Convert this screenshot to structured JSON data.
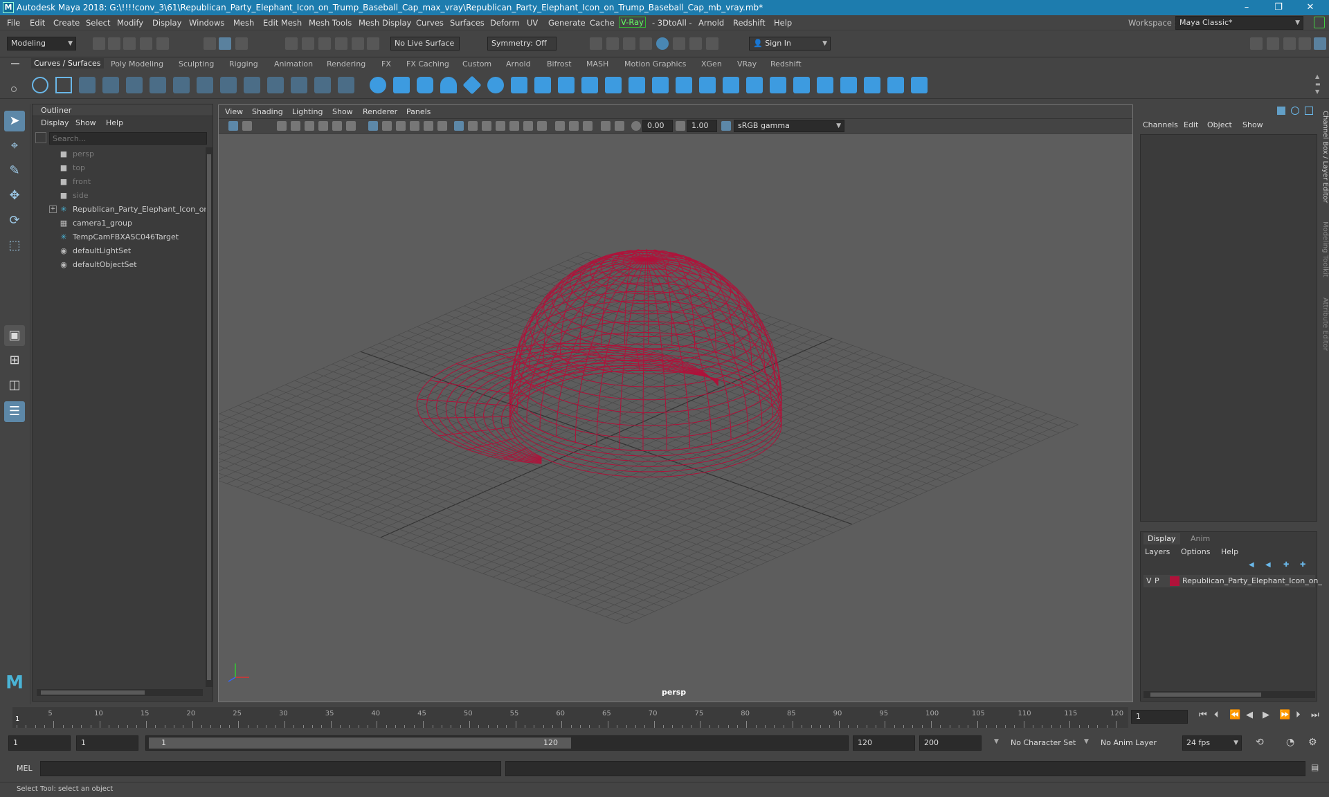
{
  "title": {
    "text": "Autodesk Maya 2018: G:\\!!!!conv_3\\61\\Republican_Party_Elephant_Icon_on_Trump_Baseball_Cap_max_vray\\Republican_Party_Elephant_Icon_on_Trump_Baseball_Cap_mb_vray.mb*",
    "logo": "M",
    "min": "–",
    "max": "❐",
    "close": "✕"
  },
  "menu": [
    "File",
    "Edit",
    "Create",
    "Select",
    "Modify",
    "Display",
    "Windows",
    "Mesh",
    "Edit Mesh",
    "Mesh Tools",
    "Mesh Display",
    "Curves",
    "Surfaces",
    "Deform",
    "UV",
    "Generate",
    "Cache",
    "V-Ray",
    "- 3DtoAll -",
    "Arnold",
    "Redshift",
    "Help"
  ],
  "workspace": {
    "label": "Workspace :",
    "value": "Maya Classic*"
  },
  "status": {
    "mode": "Modeling",
    "live_surface": "No Live Surface",
    "symmetry": "Symmetry: Off",
    "signin": "Sign In"
  },
  "shelf_tabs": [
    "Curves / Surfaces",
    "Poly Modeling",
    "Sculpting",
    "Rigging",
    "Animation",
    "Rendering",
    "FX",
    "FX Caching",
    "Custom",
    "Arnold",
    "Bifrost",
    "MASH",
    "Motion Graphics",
    "XGen",
    "VRay",
    "Redshift"
  ],
  "outliner": {
    "title": "Outliner",
    "menu": [
      "Display",
      "Show",
      "Help"
    ],
    "search_placeholder": "Search...",
    "items": [
      {
        "label": "persp",
        "icon": "camera-icon",
        "dim": true
      },
      {
        "label": "top",
        "icon": "camera-icon",
        "dim": true
      },
      {
        "label": "front",
        "icon": "camera-icon",
        "dim": true
      },
      {
        "label": "side",
        "icon": "camera-icon",
        "dim": true
      },
      {
        "label": "Republican_Party_Elephant_Icon_on_",
        "icon": "transform-icon",
        "dim": false,
        "expand": "+"
      },
      {
        "label": "camera1_group",
        "icon": "group-icon",
        "dim": false
      },
      {
        "label": "TempCamFBXASC046Target",
        "icon": "transform-icon",
        "dim": false
      },
      {
        "label": "defaultLightSet",
        "icon": "set-icon",
        "dim": false
      },
      {
        "label": "defaultObjectSet",
        "icon": "set-icon",
        "dim": false
      }
    ]
  },
  "viewport": {
    "menu": [
      "View",
      "Shading",
      "Lighting",
      "Show",
      "Renderer",
      "Panels"
    ],
    "exposure": "0.00",
    "gamma": "1.00",
    "colorspace": "sRGB gamma",
    "camera_label": "persp",
    "wire_color": "#b0123a"
  },
  "channelbox": {
    "menu": [
      "Channels",
      "Edit",
      "Object",
      "Show"
    ],
    "side_tabs": [
      "Channel Box / Layer Editor",
      "Modeling Toolkit",
      "Attribute Editor"
    ]
  },
  "layers": {
    "tabs": [
      "Display",
      "Anim"
    ],
    "menu": [
      "Layers",
      "Options",
      "Help"
    ],
    "row": {
      "v": "V",
      "p": "P",
      "name": "Republican_Party_Elephant_Icon_on_",
      "color": "#b0123a"
    }
  },
  "timeline": {
    "ticks": [
      "5",
      "10",
      "15",
      "20",
      "25",
      "30",
      "35",
      "40",
      "45",
      "50",
      "55",
      "60",
      "65",
      "70",
      "75",
      "80",
      "85",
      "90",
      "95",
      "100",
      "105",
      "110",
      "115",
      "120"
    ],
    "start_marker": "1",
    "current": "1"
  },
  "range": {
    "start": "1",
    "start2": "1",
    "slider_start": "1",
    "slider_end": "120",
    "end": "120",
    "end2": "200",
    "charset": "No Character Set",
    "animlayer": "No Anim Layer",
    "fps": "24 fps"
  },
  "cmd": {
    "lang": "MEL"
  },
  "help": {
    "text": "Select Tool: select an object"
  }
}
